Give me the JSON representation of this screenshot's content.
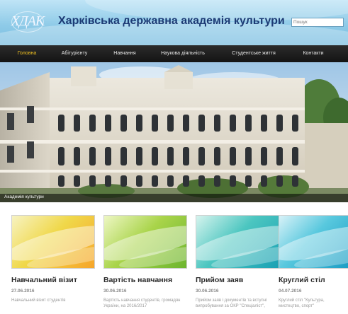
{
  "header": {
    "logo_text": "ХДАК",
    "title": "Харківська державна академія культури",
    "search_placeholder": "Пошук"
  },
  "nav": {
    "items": [
      "Головна",
      "Абітурієнту",
      "Навчання",
      "Наукова діяльність",
      "Студентське життя",
      "Контакти"
    ],
    "active_index": 0
  },
  "hero": {
    "caption": "Академія культури"
  },
  "news": [
    {
      "title": "Навчальний візит",
      "date": "27.06.2016",
      "text": "Навчальний візит студентів",
      "theme": "yellow"
    },
    {
      "title": "Вартість навчання",
      "date": "30.06.2016",
      "text": "Вартість навчання студентів, громадян України, на 2016/2017",
      "theme": "green"
    },
    {
      "title": "Прийом заяв",
      "date": "30.06.2016",
      "text": "Прийом заяв і документів та вступні випробування за ОКР \"Спеціаліст\",",
      "theme": "teal"
    },
    {
      "title": "Круглий стіл",
      "date": "04.07.2016",
      "text": "Круглий стіл \"Культура, мистецтво, спорт\"",
      "theme": "cyan"
    }
  ],
  "colors": {
    "header_title": "#1c3a74",
    "nav_bg": "#1a1a1a",
    "nav_active": "#f0c020",
    "card_title": "#2a2a2a",
    "card_date": "#8a8a8a"
  }
}
